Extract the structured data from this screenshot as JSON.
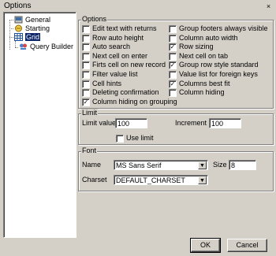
{
  "window": {
    "title": "Options",
    "close_glyph": "×"
  },
  "tree": {
    "items": [
      {
        "label": "General",
        "icon": "general-icon"
      },
      {
        "label": "Starting",
        "icon": "starting-icon"
      },
      {
        "label": "Grid",
        "icon": "grid-icon",
        "selected": true
      },
      {
        "label": "Query Builder",
        "icon": "query-builder-icon"
      }
    ]
  },
  "options": {
    "legend": "Options",
    "left": [
      {
        "label": "Edit text with returns",
        "checked": false
      },
      {
        "label": "Row auto height",
        "checked": false
      },
      {
        "label": "Auto search",
        "checked": false
      },
      {
        "label": "Next cell on enter",
        "checked": false
      },
      {
        "label": "Firts cell on new record",
        "checked": false
      },
      {
        "label": "Filter value list",
        "checked": false
      },
      {
        "label": "Cell hints",
        "checked": false
      },
      {
        "label": "Deleting confirmation",
        "checked": false
      },
      {
        "label": "Column hiding on grouping",
        "checked": true
      }
    ],
    "right": [
      {
        "label": "Group footers always visible",
        "checked": false
      },
      {
        "label": "Column auto width",
        "checked": false
      },
      {
        "label": "Row sizing",
        "checked": true
      },
      {
        "label": "Next cell on tab",
        "checked": false
      },
      {
        "label": "Group row style standard",
        "checked": true
      },
      {
        "label": "Value list for foreign keys",
        "checked": false
      },
      {
        "label": "Columns best fit",
        "checked": true
      },
      {
        "label": "Column hiding",
        "checked": false
      }
    ]
  },
  "limit": {
    "legend": "Limit",
    "limit_value_label": "Limit value",
    "limit_value": "100",
    "increment_label": "Increment",
    "increment": "100",
    "use_limit_label": "Use limit",
    "use_limit_checked": false
  },
  "font": {
    "legend": "Font",
    "name_label": "Name",
    "name_value": "MS Sans Serif",
    "size_label": "Size",
    "size_value": "8",
    "charset_label": "Charset",
    "charset_value": "DEFAULT_CHARSET"
  },
  "buttons": {
    "ok": "OK",
    "cancel": "Cancel"
  },
  "check_glyph": "✓",
  "dropdown_glyph": "▼"
}
